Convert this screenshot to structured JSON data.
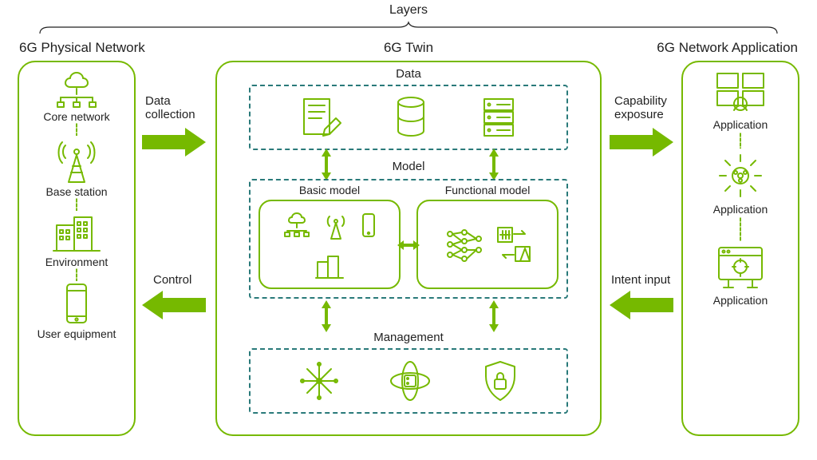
{
  "top_label": "Layers",
  "columns": {
    "left_title": "6G Physical Network",
    "center_title": "6G Twin",
    "right_title": "6G Network Application"
  },
  "left_items": {
    "core": "Core network",
    "bs": "Base station",
    "env": "Environment",
    "ue": "User equipment"
  },
  "right_items": {
    "app1": "Application",
    "app2": "Application",
    "app3": "Application"
  },
  "center": {
    "data": "Data",
    "model": "Model",
    "basic_model": "Basic model",
    "functional_model": "Functional model",
    "management": "Management"
  },
  "arrows": {
    "data_collection": "Data\ncollection",
    "control": "Control",
    "capability_exposure": "Capability\nexposure",
    "intent_input": "Intent input"
  }
}
